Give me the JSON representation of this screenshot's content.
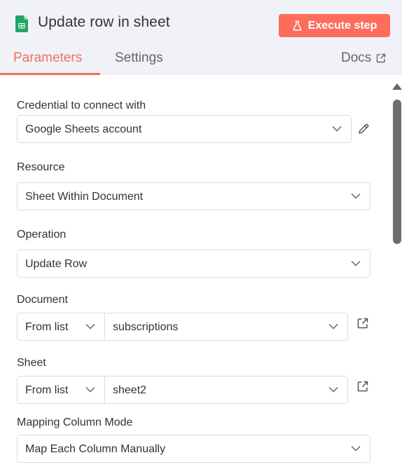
{
  "header": {
    "app_icon": "google-sheets-icon",
    "title": "Update row in sheet",
    "execute_label": "Execute step",
    "execute_icon": "flask-icon",
    "accent_color": "#fe6d5b"
  },
  "tabs": [
    {
      "label": "Parameters",
      "active": true
    },
    {
      "label": "Settings",
      "active": false
    }
  ],
  "docs": {
    "label": "Docs",
    "icon": "external-link-icon"
  },
  "fields": {
    "credential": {
      "label": "Credential to connect with",
      "value": "Google Sheets account",
      "side_icon": "pencil-icon"
    },
    "resource": {
      "label": "Resource",
      "value": "Sheet Within Document"
    },
    "operation": {
      "label": "Operation",
      "value": "Update Row"
    },
    "document": {
      "label": "Document",
      "mode": "From list",
      "value": "subscriptions",
      "side_icon": "external-link-icon"
    },
    "sheet": {
      "label": "Sheet",
      "mode": "From list",
      "value": "sheet2",
      "side_icon": "external-link-icon"
    },
    "mapping": {
      "label": "Mapping Column Mode",
      "value": "Map Each Column Manually"
    }
  }
}
